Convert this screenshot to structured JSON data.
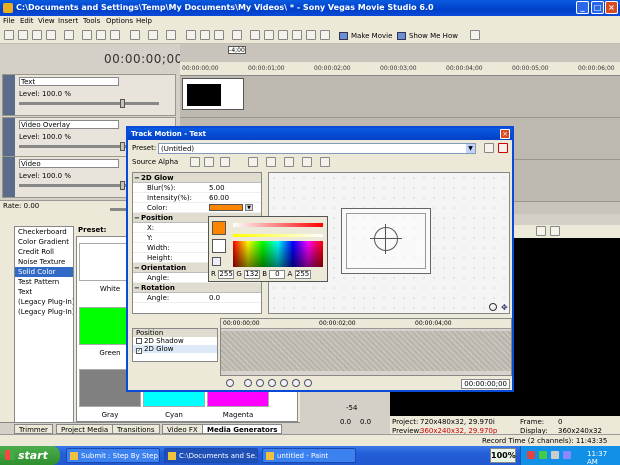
{
  "window": {
    "title": "C:\\Documents and Settings\\Temp\\My Documents\\My Videos\\ * - Sony Vegas Movie Studio 6.0",
    "minimize": "_",
    "maximize": "□",
    "close": "×"
  },
  "menu": [
    "File",
    "Edit",
    "View",
    "Insert",
    "Tools",
    "Options",
    "Help"
  ],
  "toolbar": {
    "make_movie": "Make Movie",
    "show_me_how": "Show Me How"
  },
  "timeline": {
    "timecode": "00:00:00;00",
    "cursor_label": "-4;00",
    "ruler": [
      "00:00:00;00",
      "00:00:01;00",
      "00:00:02;00",
      "00:00:03;00",
      "00:00:04;00",
      "00:00:05;00",
      "00:00:06;00"
    ]
  },
  "tracks": [
    {
      "name": "Text",
      "level": "Level: 100.0 %"
    },
    {
      "name": "Video Overlay",
      "level": "Level: 100.0 %"
    },
    {
      "name": "Video",
      "level": "Level: 100.0 %"
    }
  ],
  "rate": "Rate: 0.00",
  "generators": {
    "list": [
      "Checkerboard",
      "Color Gradient",
      "Credit Roll",
      "Noise Texture",
      "Solid Color",
      "Test Pattern",
      "Text",
      "(Legacy Plug-In) Ti",
      "(Legacy Plug-In) V"
    ],
    "selected_index": 4,
    "preset_label": "Preset:",
    "swatches": [
      {
        "label": "White",
        "color": "#ffffff"
      },
      {
        "label": "Green",
        "color": "#00ff00"
      },
      {
        "label": "Gray",
        "color": "#808080"
      },
      {
        "label": "Cyan",
        "color": "#00ffff"
      },
      {
        "label": "Magenta",
        "color": "#ff00ff"
      }
    ]
  },
  "tabs": [
    "Trimmer",
    "Project Media",
    "Transitions",
    "Video FX",
    "Media Generators"
  ],
  "active_tab": "Media Generators",
  "dialog": {
    "title": "Track Motion - Text",
    "preset_label": "Preset:",
    "preset_value": "(Untitled)",
    "source_alpha": "Source Alpha",
    "props": {
      "glow_section": "2D Glow",
      "blur_label": "Blur(%):",
      "blur_value": "5.00",
      "intensity_label": "Intensity(%):",
      "intensity_value": "60.00",
      "color_label": "Color:",
      "position_section": "Position",
      "x_label": "X:",
      "y_label": "Y:",
      "width_label": "Width:",
      "height_label": "Height:",
      "orientation_section": "Orientation",
      "angle_label": "Angle:",
      "rotation_section": "Rotation",
      "rot_angle_label": "Angle:",
      "rot_angle_value": "0.0"
    },
    "picker": {
      "r_label": "R",
      "r": "255",
      "g_label": "G",
      "g": "132",
      "b_label": "B",
      "b": "0",
      "a_label": "A",
      "a": "255"
    },
    "postrack": {
      "title": "Position",
      "items": [
        "2D Shadow",
        "2D Glow"
      ],
      "checked": [
        false,
        true
      ]
    },
    "kf_ruler": [
      "00:00:00;00",
      "00:00:02;00",
      "00:00:04;00"
    ],
    "kf_time": "00:00:00;00"
  },
  "mixer": {
    "left_val": "0.0",
    "right_val": "0.0",
    "db": "-54"
  },
  "preview": {
    "project_label": "Project:",
    "project_val": "720x480x32, 29.970i",
    "preview_label": "Preview:",
    "preview_val": "360x240x32, 29.970p",
    "frame_label": "Frame:",
    "frame_val": "0",
    "display_label": "Display:",
    "display_val": "360x240x32",
    "record_time": "Record Time (2 channels): 11:43:35"
  },
  "taskbar": {
    "start": "start",
    "items": [
      "Submit : Step By Step...",
      "C:\\Documents and Se...",
      "untitled - Paint"
    ],
    "zoom": "100%",
    "clock": "11:37 AM"
  },
  "colors": {
    "titlebar": "#0a5adf",
    "accent": "#316ac5",
    "picker_color": "#ff8400"
  }
}
